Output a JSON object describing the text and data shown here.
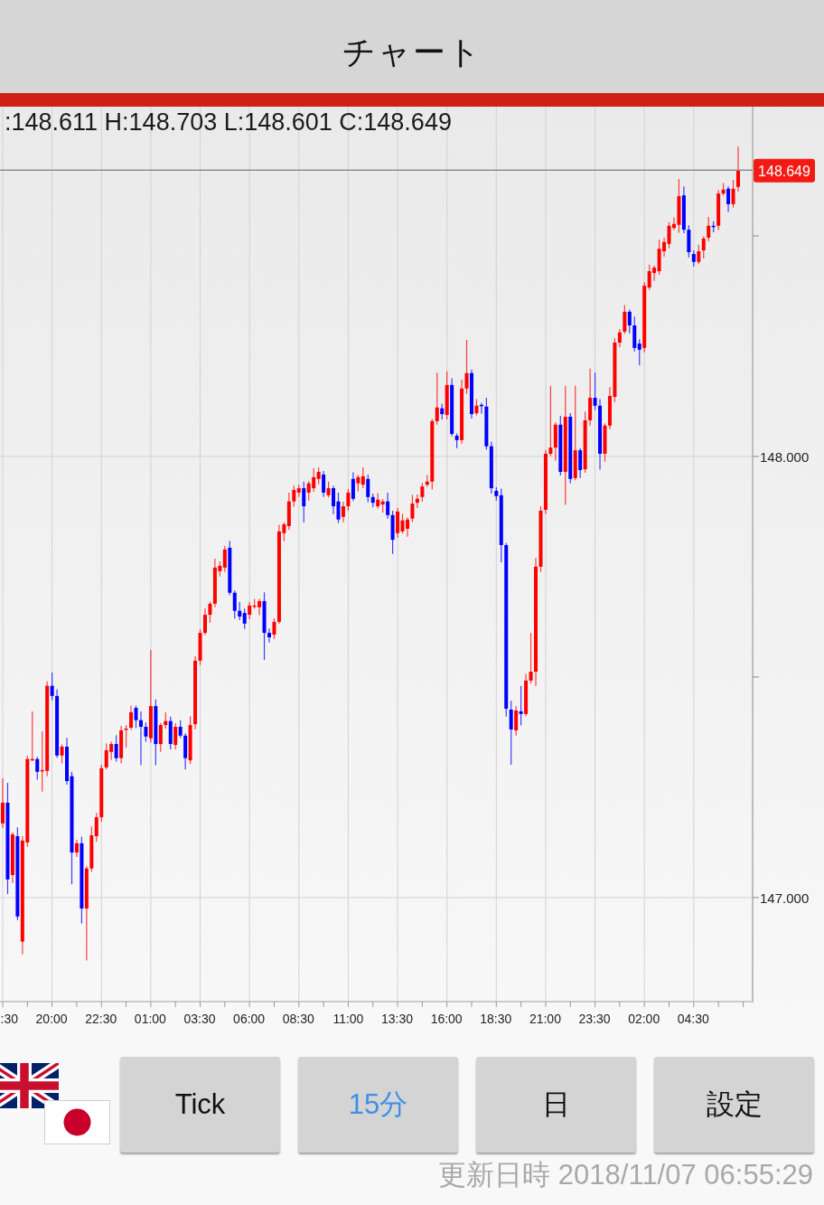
{
  "title_bar": {
    "title": "チャート"
  },
  "chart": {
    "ohlc_readout": ":148.611 H:148.703 L:148.601 C:148.649",
    "current_price": "148.649",
    "chart_data": {
      "type": "candlestick",
      "ylim": [
        146.764,
        148.793
      ],
      "yticks": [
        {
          "value": 148,
          "label": "148.000"
        },
        {
          "value": 147,
          "label": "147.000"
        }
      ],
      "ref_lines": [
        {
          "axis": "y",
          "value": 148.649
        }
      ],
      "categories": [
        ":30",
        null,
        null,
        null,
        null,
        null,
        null,
        null,
        null,
        null,
        "20:00",
        null,
        null,
        null,
        null,
        null,
        null,
        null,
        null,
        null,
        "22:30",
        null,
        null,
        null,
        null,
        null,
        null,
        null,
        null,
        null,
        "01:00",
        null,
        null,
        null,
        null,
        null,
        null,
        null,
        null,
        null,
        "03:30",
        null,
        null,
        null,
        null,
        null,
        null,
        null,
        null,
        null,
        "06:00",
        null,
        null,
        null,
        null,
        null,
        null,
        null,
        null,
        null,
        "08:30",
        null,
        null,
        null,
        null,
        null,
        null,
        null,
        null,
        null,
        "11:00",
        null,
        null,
        null,
        null,
        null,
        null,
        null,
        null,
        null,
        "13:30",
        null,
        null,
        null,
        null,
        null,
        null,
        null,
        null,
        null,
        "16:00",
        null,
        null,
        null,
        null,
        null,
        null,
        null,
        null,
        null,
        "18:30",
        null,
        null,
        null,
        null,
        null,
        null,
        null,
        null,
        null,
        "21:00",
        null,
        null,
        null,
        null,
        null,
        null,
        null,
        null,
        null,
        "23:30",
        null,
        null,
        null,
        null,
        null,
        null,
        null,
        null,
        null,
        "02:00",
        null,
        null,
        null,
        null,
        null,
        null,
        null,
        null,
        null,
        "04:30",
        null,
        null,
        null,
        null,
        null,
        null,
        null,
        null,
        null
      ],
      "ohlc": [
        [
          147.168,
          147.27,
          147.158,
          147.215
        ],
        [
          147.215,
          147.26,
          147.008,
          147.041
        ],
        [
          147.051,
          147.148,
          147.033,
          147.143
        ],
        [
          147.139,
          147.159,
          146.949,
          146.957
        ],
        [
          146.9,
          147.139,
          146.871,
          147.129
        ],
        [
          147.125,
          147.322,
          147.115,
          147.314
        ],
        [
          147.311,
          147.422,
          147.309,
          147.314
        ],
        [
          147.314,
          147.319,
          147.267,
          147.285
        ],
        [
          147.287,
          147.377,
          147.24,
          147.289
        ],
        [
          147.287,
          147.49,
          147.275,
          147.48
        ],
        [
          147.48,
          147.51,
          147.447,
          147.457
        ],
        [
          147.457,
          147.472,
          147.317,
          147.322
        ],
        [
          147.322,
          147.347,
          147.304,
          147.342
        ],
        [
          147.342,
          147.362,
          147.256,
          147.264
        ],
        [
          147.275,
          147.285,
          147.03,
          147.102
        ],
        [
          147.102,
          147.131,
          147.092,
          147.123
        ],
        [
          147.123,
          147.138,
          146.941,
          146.975
        ],
        [
          146.975,
          147.071,
          146.857,
          147.066
        ],
        [
          147.066,
          147.161,
          147.058,
          147.141
        ],
        [
          147.139,
          147.192,
          147.127,
          147.182
        ],
        [
          147.182,
          147.301,
          147.172,
          147.293
        ],
        [
          147.295,
          147.349,
          147.29,
          147.334
        ],
        [
          147.33,
          147.353,
          147.312,
          147.348
        ],
        [
          147.348,
          147.368,
          147.308,
          147.316
        ],
        [
          147.316,
          147.389,
          147.304,
          147.379
        ],
        [
          147.381,
          147.391,
          147.34,
          147.383
        ],
        [
          147.385,
          147.435,
          147.38,
          147.42
        ],
        [
          147.43,
          147.435,
          147.384,
          147.402
        ],
        [
          147.402,
          147.422,
          147.3,
          147.387
        ],
        [
          147.387,
          147.397,
          147.353,
          147.365
        ],
        [
          147.361,
          147.561,
          147.351,
          147.434
        ],
        [
          147.434,
          147.449,
          147.3,
          147.348
        ],
        [
          147.348,
          147.396,
          147.33,
          147.391
        ],
        [
          147.391,
          147.42,
          147.383,
          147.4
        ],
        [
          147.4,
          147.41,
          147.336,
          147.348
        ],
        [
          147.346,
          147.395,
          147.336,
          147.387
        ],
        [
          147.387,
          147.402,
          147.362,
          147.367
        ],
        [
          147.367,
          147.372,
          147.29,
          147.316
        ],
        [
          147.311,
          147.411,
          147.303,
          147.391
        ],
        [
          147.393,
          147.547,
          147.381,
          147.537
        ],
        [
          147.537,
          147.608,
          147.527,
          147.6
        ],
        [
          147.6,
          147.656,
          147.595,
          147.641
        ],
        [
          147.641,
          147.671,
          147.623,
          147.666
        ],
        [
          147.666,
          147.768,
          147.658,
          147.748
        ],
        [
          147.74,
          147.762,
          147.728,
          147.752
        ],
        [
          147.748,
          147.797,
          147.738,
          147.789
        ],
        [
          147.793,
          147.808,
          147.686,
          147.691
        ],
        [
          147.691,
          147.696,
          147.632,
          147.65
        ],
        [
          147.65,
          147.67,
          147.629,
          147.637
        ],
        [
          147.645,
          147.655,
          147.609,
          147.621
        ],
        [
          147.641,
          147.67,
          147.631,
          147.662
        ],
        [
          147.66,
          147.677,
          147.655,
          147.662
        ],
        [
          147.658,
          147.677,
          147.64,
          147.672
        ],
        [
          147.672,
          147.692,
          147.539,
          147.6
        ],
        [
          147.6,
          147.61,
          147.578,
          147.59
        ],
        [
          147.596,
          147.633,
          147.586,
          147.625
        ],
        [
          147.625,
          147.845,
          147.62,
          147.83
        ],
        [
          147.826,
          147.851,
          147.808,
          147.846
        ],
        [
          147.842,
          147.918,
          147.834,
          147.898
        ],
        [
          147.898,
          147.934,
          147.886,
          147.924
        ],
        [
          147.918,
          147.936,
          147.908,
          147.928
        ],
        [
          147.928,
          147.943,
          147.85,
          147.887
        ],
        [
          147.918,
          147.944,
          147.9,
          147.939
        ],
        [
          147.928,
          147.973,
          147.92,
          147.953
        ],
        [
          147.949,
          147.975,
          147.937,
          147.965
        ],
        [
          147.959,
          147.967,
          147.908,
          147.918
        ],
        [
          147.912,
          147.943,
          147.907,
          147.928
        ],
        [
          147.928,
          147.933,
          147.869,
          147.887
        ],
        [
          147.898,
          147.918,
          147.849,
          147.857
        ],
        [
          147.863,
          147.897,
          147.851,
          147.887
        ],
        [
          147.887,
          147.926,
          147.877,
          147.918
        ],
        [
          147.949,
          147.964,
          147.899,
          147.904
        ],
        [
          147.939,
          147.958,
          147.921,
          147.953
        ],
        [
          147.936,
          147.975,
          147.928,
          147.955
        ],
        [
          147.949,
          147.959,
          147.896,
          147.908
        ],
        [
          147.908,
          147.916,
          147.885,
          147.895
        ],
        [
          147.887,
          147.917,
          147.882,
          147.902
        ],
        [
          147.891,
          147.903,
          147.873,
          147.898
        ],
        [
          147.898,
          147.918,
          147.859,
          147.867
        ],
        [
          147.867,
          147.877,
          147.779,
          147.811
        ],
        [
          147.826,
          147.883,
          147.816,
          147.875
        ],
        [
          147.83,
          147.87,
          147.825,
          147.855
        ],
        [
          147.836,
          147.862,
          147.818,
          147.857
        ],
        [
          147.859,
          147.913,
          147.851,
          147.893
        ],
        [
          147.895,
          147.914,
          147.883,
          147.904
        ],
        [
          147.908,
          147.94,
          147.898,
          147.932
        ],
        [
          147.936,
          147.958,
          147.931,
          147.943
        ],
        [
          147.943,
          148.085,
          147.925,
          148.08
        ],
        [
          148.08,
          148.19,
          148.072,
          148.111
        ],
        [
          148.109,
          148.119,
          148.084,
          148.096
        ],
        [
          148.094,
          148.193,
          148.084,
          148.162
        ],
        [
          148.162,
          148.177,
          148.046,
          148.051
        ],
        [
          148.047,
          148.052,
          148.019,
          148.037
        ],
        [
          148.037,
          148.174,
          148.029,
          148.154
        ],
        [
          148.154,
          148.264,
          148.142,
          148.189
        ],
        [
          148.189,
          148.197,
          148.086,
          148.096
        ],
        [
          148.098,
          148.13,
          148.093,
          148.115
        ],
        [
          148.117,
          148.122,
          148.097,
          148.115
        ],
        [
          148.113,
          148.133,
          148.015,
          148.023
        ],
        [
          148.023,
          148.033,
          147.916,
          147.928
        ],
        [
          147.922,
          147.93,
          147.9,
          147.91
        ],
        [
          147.912,
          147.927,
          147.76,
          147.799
        ],
        [
          147.799,
          147.804,
          147.41,
          147.428
        ],
        [
          147.426,
          147.446,
          147.301,
          147.381
        ],
        [
          147.379,
          147.434,
          147.367,
          147.424
        ],
        [
          147.422,
          147.48,
          147.39,
          147.416
        ],
        [
          147.416,
          147.507,
          147.411,
          147.492
        ],
        [
          147.492,
          147.6,
          147.485,
          147.512
        ],
        [
          147.512,
          147.77,
          147.48,
          147.75
        ],
        [
          147.75,
          147.887,
          147.738,
          147.877
        ],
        [
          147.879,
          148.014,
          147.869,
          148.006
        ],
        [
          148.006,
          148.16,
          148.001,
          148.02
        ],
        [
          148.02,
          148.077,
          147.99,
          148.072
        ],
        [
          148.072,
          148.092,
          147.957,
          147.965
        ],
        [
          147.965,
          148.16,
          147.89,
          148.09
        ],
        [
          148.09,
          148.098,
          147.939,
          147.949
        ],
        [
          147.951,
          148.16,
          147.946,
          148.014
        ],
        [
          148.014,
          148.019,
          147.951,
          147.969
        ],
        [
          147.971,
          148.102,
          147.963,
          148.082
        ],
        [
          148.082,
          148.199,
          148.07,
          148.133
        ],
        [
          148.133,
          148.19,
          148.105,
          148.115
        ],
        [
          148.115,
          148.13,
          147.97,
          148.006
        ],
        [
          148.006,
          148.075,
          147.988,
          148.07
        ],
        [
          148.07,
          148.157,
          148.062,
          148.137
        ],
        [
          148.135,
          148.268,
          148.123,
          148.258
        ],
        [
          148.258,
          148.289,
          148.248,
          148.281
        ],
        [
          148.283,
          148.343,
          148.278,
          148.328
        ],
        [
          148.328,
          148.333,
          148.279,
          148.297
        ],
        [
          148.297,
          148.317,
          148.238,
          148.246
        ],
        [
          148.256,
          148.266,
          148.207,
          148.242
        ],
        [
          148.246,
          148.395,
          148.236,
          148.387
        ],
        [
          148.383,
          148.435,
          148.378,
          148.42
        ],
        [
          148.416,
          148.433,
          148.398,
          148.428
        ],
        [
          148.42,
          148.491,
          148.412,
          148.471
        ],
        [
          148.465,
          148.496,
          148.453,
          148.486
        ],
        [
          148.482,
          148.531,
          148.472,
          148.523
        ],
        [
          148.518,
          148.542,
          148.513,
          148.527
        ],
        [
          148.525,
          148.629,
          148.507,
          148.59
        ],
        [
          148.592,
          148.612,
          148.506,
          148.514
        ],
        [
          148.514,
          148.524,
          148.451,
          148.463
        ],
        [
          148.459,
          148.467,
          148.431,
          148.441
        ],
        [
          148.441,
          148.48,
          148.436,
          148.465
        ],
        [
          148.467,
          148.499,
          148.449,
          148.494
        ],
        [
          148.496,
          148.543,
          148.488,
          148.523
        ],
        [
          148.523,
          148.533,
          148.508,
          148.52
        ],
        [
          148.523,
          148.604,
          148.513,
          148.596
        ],
        [
          148.596,
          148.62,
          148.591,
          148.605
        ],
        [
          148.607,
          148.612,
          148.554,
          148.572
        ],
        [
          148.572,
          148.627,
          148.564,
          148.607
        ],
        [
          148.611,
          148.703,
          148.601,
          148.649
        ]
      ]
    }
  },
  "buttons": [
    {
      "label": "Tick",
      "selected": false
    },
    {
      "label": "15分",
      "selected": true
    },
    {
      "label": "日",
      "selected": false
    },
    {
      "label": "設定",
      "selected": false
    }
  ],
  "updated": "更新日時 2018/11/07 06:55:29"
}
